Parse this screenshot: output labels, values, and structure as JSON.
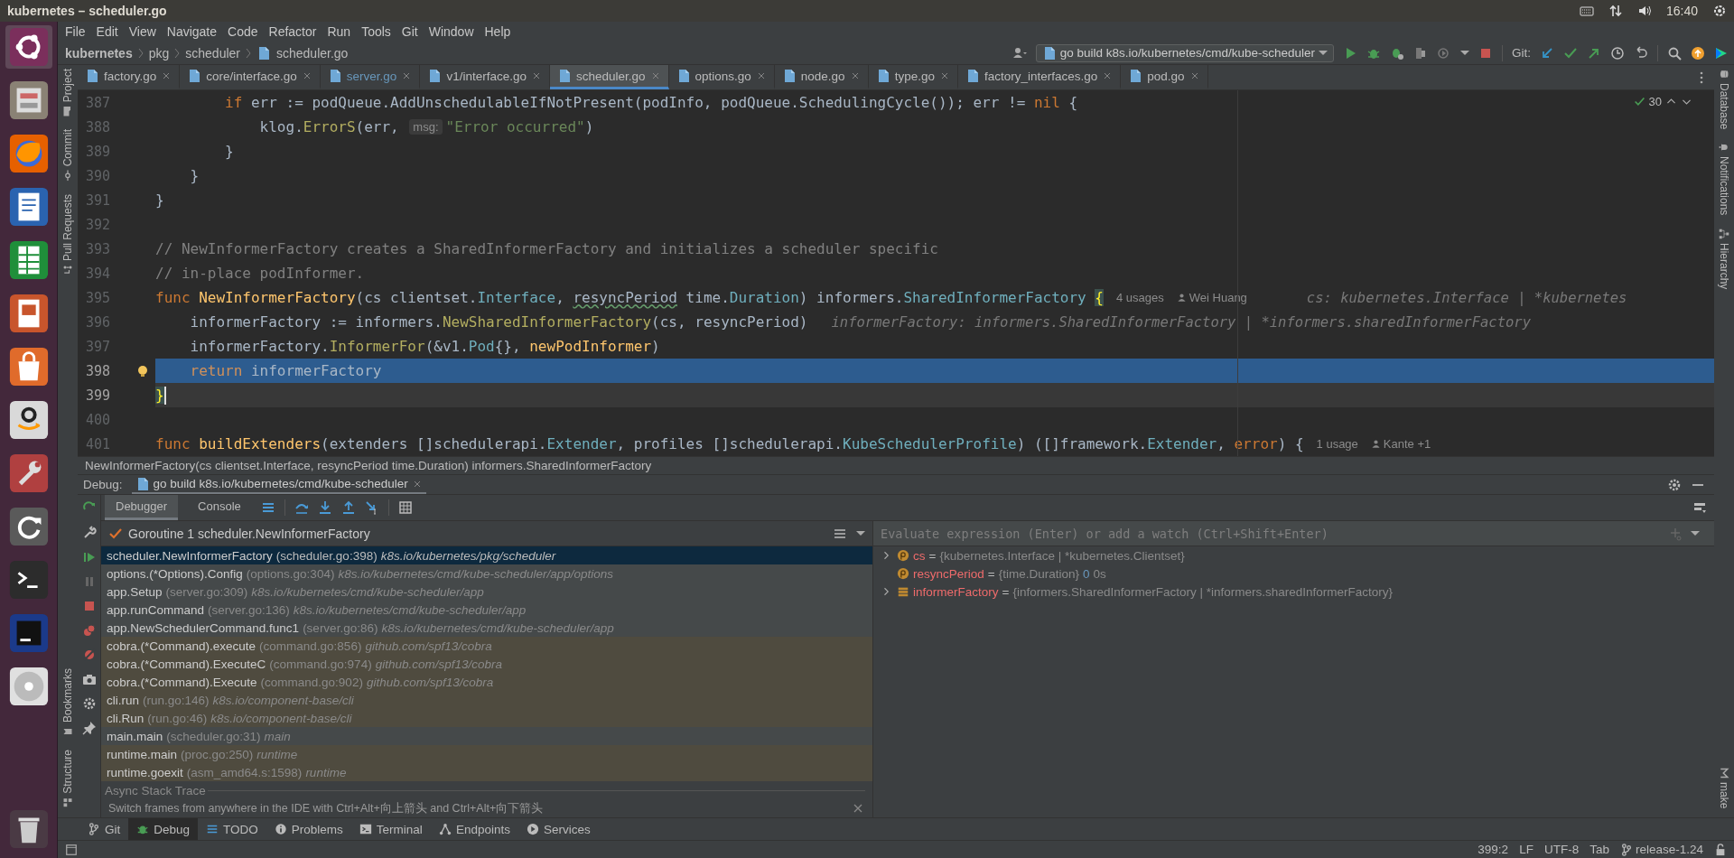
{
  "window": {
    "title": "kubernetes – scheduler.go"
  },
  "system_tray": {
    "clock": "16:40"
  },
  "menu": [
    "File",
    "Edit",
    "View",
    "Navigate",
    "Code",
    "Refactor",
    "Run",
    "Tools",
    "Git",
    "Window",
    "Help"
  ],
  "breadcrumbs": [
    "kubernetes",
    "pkg",
    "scheduler",
    "scheduler.go"
  ],
  "run_configuration": "go build k8s.io/kubernetes/cmd/kube-scheduler",
  "git_label": "Git:",
  "left_tool_windows": {
    "top": [
      {
        "label": "Project",
        "kind": "project"
      },
      {
        "label": "Commit",
        "kind": "commit"
      },
      {
        "label": "Pull Requests",
        "kind": "pull-requests"
      }
    ],
    "bottom": [
      {
        "label": "Bookmarks",
        "kind": "bookmarks"
      },
      {
        "label": "Structure",
        "kind": "structure"
      }
    ]
  },
  "right_tool_windows": {
    "top": [
      {
        "label": "Database",
        "kind": "database"
      },
      {
        "label": "Notifications",
        "kind": "notifications"
      },
      {
        "label": "Hierarchy",
        "kind": "hierarchy"
      }
    ],
    "bottom": [
      {
        "label": "make",
        "kind": "make"
      }
    ]
  },
  "editor_tabs": [
    {
      "label": "factory.go",
      "selected": false,
      "modified": false
    },
    {
      "label": "core/interface.go",
      "selected": false,
      "modified": false
    },
    {
      "label": "server.go",
      "selected": false,
      "modified": true
    },
    {
      "label": "v1/interface.go",
      "selected": false,
      "modified": false
    },
    {
      "label": "scheduler.go",
      "selected": true,
      "modified": false
    },
    {
      "label": "options.go",
      "selected": false,
      "modified": false
    },
    {
      "label": "node.go",
      "selected": false,
      "modified": false
    },
    {
      "label": "type.go",
      "selected": false,
      "modified": false
    },
    {
      "label": "factory_interfaces.go",
      "selected": false,
      "modified": false
    },
    {
      "label": "pod.go",
      "selected": false,
      "modified": false
    }
  ],
  "inspections": {
    "count": "30"
  },
  "code_lines": [
    {
      "number": "387",
      "current": false,
      "caret": false,
      "segments": [
        {
          "kind": "code",
          "tokens": [
            {
              "kind": "kw",
              "text": "        if"
            },
            {
              "kind": "plain",
              "text": " err := podQueue.AddUnschedulableIfNotPresent(podInfo, podQueue.SchedulingCycle()); err != "
            },
            {
              "kind": "kw",
              "text": "nil"
            },
            {
              "kind": "plain",
              "text": " {"
            }
          ]
        }
      ]
    },
    {
      "number": "388",
      "current": false,
      "caret": false,
      "segments": [
        {
          "kind": "code",
          "tokens": [
            {
              "kind": "plain",
              "text": "            klog."
            },
            {
              "kind": "call",
              "text": "ErrorS"
            },
            {
              "kind": "plain",
              "text": "(err, "
            }
          ]
        },
        {
          "kind": "param-hint",
          "text": "msg:"
        },
        {
          "kind": "code",
          "tokens": [
            {
              "kind": "str",
              "text": "\"Error occurred\""
            },
            {
              "kind": "plain",
              "text": ")"
            }
          ]
        }
      ]
    },
    {
      "number": "389",
      "current": false,
      "caret": false,
      "segments": [
        {
          "kind": "code",
          "tokens": [
            {
              "kind": "plain",
              "text": "        }"
            }
          ]
        }
      ]
    },
    {
      "number": "390",
      "current": false,
      "caret": false,
      "segments": [
        {
          "kind": "code",
          "tokens": [
            {
              "kind": "plain",
              "text": "    }"
            }
          ]
        }
      ]
    },
    {
      "number": "391",
      "current": false,
      "caret": false,
      "segments": [
        {
          "kind": "code",
          "tokens": [
            {
              "kind": "plain",
              "text": "}"
            }
          ]
        }
      ]
    },
    {
      "number": "392",
      "current": false,
      "caret": false
    },
    {
      "number": "393",
      "current": false,
      "caret": false,
      "segments": [
        {
          "kind": "code",
          "tokens": [
            {
              "kind": "comment",
              "text": "// NewInformerFactory creates a SharedInformerFactory and initializes a scheduler specific"
            }
          ]
        }
      ]
    },
    {
      "number": "394",
      "current": false,
      "caret": false,
      "segments": [
        {
          "kind": "code",
          "tokens": [
            {
              "kind": "comment",
              "text": "// in-place podInformer."
            }
          ]
        }
      ]
    },
    {
      "number": "395",
      "current": false,
      "caret": false,
      "segments": [
        {
          "kind": "code",
          "tokens": [
            {
              "kind": "kw",
              "text": "func "
            },
            {
              "kind": "decl",
              "text": "NewInformerFactory"
            },
            {
              "kind": "plain",
              "text": "(cs clientset."
            },
            {
              "kind": "type",
              "text": "Interface"
            },
            {
              "kind": "plain",
              "text": ", "
            },
            {
              "kind": "typo",
              "text": "resyncPeriod"
            },
            {
              "kind": "plain",
              "text": " time."
            },
            {
              "kind": "type",
              "text": "Duration"
            },
            {
              "kind": "plain",
              "text": ") informers."
            },
            {
              "kind": "type",
              "text": "SharedInformerFactory "
            },
            {
              "kind": "brace",
              "text": "{"
            }
          ]
        },
        {
          "kind": "usages",
          "text": "4 usages"
        },
        {
          "kind": "author",
          "text": "Wei Huang"
        },
        {
          "kind": "type-hint",
          "text": "cs: kubernetes.Interface | *kubernetes"
        }
      ]
    },
    {
      "number": "396",
      "current": false,
      "caret": false,
      "segments": [
        {
          "kind": "code",
          "tokens": [
            {
              "kind": "plain",
              "text": "    informerFactory := informers."
            },
            {
              "kind": "call",
              "text": "NewSharedInformerFactory"
            },
            {
              "kind": "plain",
              "text": "(cs, resyncPeriod)"
            }
          ]
        },
        {
          "kind": "type-hint",
          "text": "informerFactory: informers.SharedInformerFactory | *informers.sharedInformerFactory"
        }
      ]
    },
    {
      "number": "397",
      "current": false,
      "caret": false,
      "segments": [
        {
          "kind": "code",
          "tokens": [
            {
              "kind": "plain",
              "text": "    informerFactory."
            },
            {
              "kind": "call",
              "text": "InformerFor"
            },
            {
              "kind": "plain",
              "text": "(&v1."
            },
            {
              "kind": "type",
              "text": "Pod"
            },
            {
              "kind": "plain",
              "text": "{}, "
            },
            {
              "kind": "decl",
              "text": "newPodInformer"
            },
            {
              "kind": "plain",
              "text": ")"
            }
          ]
        }
      ]
    },
    {
      "number": "398",
      "current": true,
      "caret": false,
      "segments": [
        {
          "kind": "code",
          "tokens": [
            {
              "kind": "kw",
              "text": "    return"
            },
            {
              "kind": "plain",
              "text": " informerFactory"
            }
          ]
        }
      ]
    },
    {
      "number": "399",
      "current": false,
      "caret": true,
      "segments": [
        {
          "kind": "code",
          "tokens": [
            {
              "kind": "brace",
              "text": "}"
            }
          ]
        }
      ]
    },
    {
      "number": "400",
      "current": false,
      "caret": false
    },
    {
      "number": "401",
      "current": false,
      "caret": false,
      "segments": [
        {
          "kind": "code",
          "tokens": [
            {
              "kind": "kw",
              "text": "func "
            },
            {
              "kind": "decl",
              "text": "buildExtenders"
            },
            {
              "kind": "plain",
              "text": "(extenders []schedulerapi."
            },
            {
              "kind": "type",
              "text": "Extender"
            },
            {
              "kind": "plain",
              "text": ", profiles []schedulerapi."
            },
            {
              "kind": "type",
              "text": "KubeSchedulerProfile"
            },
            {
              "kind": "plain",
              "text": ") ([]framework."
            },
            {
              "kind": "type",
              "text": "Extender"
            },
            {
              "kind": "plain",
              "text": ", "
            },
            {
              "kind": "kw",
              "text": "error"
            },
            {
              "kind": "plain",
              "text": ") {"
            }
          ]
        },
        {
          "kind": "usages",
          "text": "1 usage"
        },
        {
          "kind": "author",
          "text": "Kante +1"
        }
      ]
    }
  ],
  "signature_hint": "NewInformerFactory(cs clientset.Interface, resyncPeriod time.Duration) informers.SharedInformerFactory",
  "debug": {
    "label": "Debug:",
    "session_tab": "go build k8s.io/kubernetes/cmd/kube-scheduler",
    "tabs": [
      {
        "label": "Debugger",
        "selected": true
      },
      {
        "label": "Console",
        "selected": false
      }
    ],
    "thread": "Goroutine 1 scheduler.NewInformerFactory",
    "frames": [
      {
        "function": "scheduler.NewInformerFactory",
        "location": "(scheduler.go:398)",
        "package": "k8s.io/kubernetes/pkg/scheduler",
        "kind": "project",
        "selected": true
      },
      {
        "function": "options.(*Options).Config",
        "location": "(options.go:304)",
        "package": "k8s.io/kubernetes/cmd/kube-scheduler/app/options",
        "kind": "project",
        "selected": false
      },
      {
        "function": "app.Setup",
        "location": "(server.go:309)",
        "package": "k8s.io/kubernetes/cmd/kube-scheduler/app",
        "kind": "project",
        "selected": false
      },
      {
        "function": "app.runCommand",
        "location": "(server.go:136)",
        "package": "k8s.io/kubernetes/cmd/kube-scheduler/app",
        "kind": "project",
        "selected": false
      },
      {
        "function": "app.NewSchedulerCommand.func1",
        "location": "(server.go:86)",
        "package": "k8s.io/kubernetes/cmd/kube-scheduler/app",
        "kind": "project",
        "selected": false
      },
      {
        "function": "cobra.(*Command).execute",
        "location": "(command.go:856)",
        "package": "github.com/spf13/cobra",
        "kind": "library",
        "selected": false
      },
      {
        "function": "cobra.(*Command).ExecuteC",
        "location": "(command.go:974)",
        "package": "github.com/spf13/cobra",
        "kind": "library",
        "selected": false
      },
      {
        "function": "cobra.(*Command).Execute",
        "location": "(command.go:902)",
        "package": "github.com/spf13/cobra",
        "kind": "library",
        "selected": false
      },
      {
        "function": "cli.run",
        "location": "(run.go:146)",
        "package": "k8s.io/component-base/cli",
        "kind": "library",
        "selected": false
      },
      {
        "function": "cli.Run",
        "location": "(run.go:46)",
        "package": "k8s.io/component-base/cli",
        "kind": "library",
        "selected": false
      },
      {
        "function": "main.main",
        "location": "(scheduler.go:31)",
        "package": "main",
        "kind": "project",
        "selected": false
      },
      {
        "function": "runtime.main",
        "location": "(proc.go:250)",
        "package": "runtime",
        "kind": "library",
        "selected": false
      },
      {
        "function": "runtime.goexit",
        "location": "(asm_amd64.s:1598)",
        "package": "runtime",
        "kind": "library",
        "selected": false
      }
    ],
    "async_label": "Async Stack Trace",
    "hint": "Switch frames from anywhere in the IDE with Ctrl+Alt+向上箭头 and Ctrl+Alt+向下箭头",
    "evaluate_placeholder": "Evaluate expression (Enter) or add a watch (Ctrl+Shift+Enter)",
    "variables": [
      {
        "kind": "param",
        "name": "cs",
        "operator": "=",
        "expandable": true,
        "type": "{kubernetes.Interface | *kubernetes.Clientset}"
      },
      {
        "kind": "param",
        "name": "resyncPeriod",
        "operator": "=",
        "expandable": false,
        "type": "{time.Duration}",
        "value": "0",
        "note": "0s"
      },
      {
        "kind": "field",
        "name": "informerFactory",
        "operator": "=",
        "expandable": true,
        "type": "{informers.SharedInformerFactory | *informers.sharedInformerFactory}"
      }
    ]
  },
  "tool_tabs": [
    {
      "label": "Git",
      "kind": "git",
      "selected": false
    },
    {
      "label": "Debug",
      "kind": "debug",
      "selected": true
    },
    {
      "label": "TODO",
      "kind": "todo",
      "selected": false
    },
    {
      "label": "Problems",
      "kind": "problems",
      "selected": false
    },
    {
      "label": "Terminal",
      "kind": "terminal",
      "selected": false
    },
    {
      "label": "Endpoints",
      "kind": "endpoints",
      "selected": false
    },
    {
      "label": "Services",
      "kind": "services",
      "selected": false
    }
  ],
  "status_bar": {
    "position": "399:2",
    "line_separator": "LF",
    "encoding": "UTF-8",
    "indent": "Tab",
    "branch": "release-1.24"
  }
}
